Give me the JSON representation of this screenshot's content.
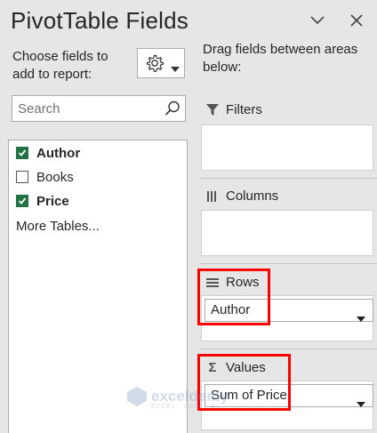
{
  "header": {
    "title": "PivotTable Fields"
  },
  "left_panel": {
    "choose_label": "Choose fields to add to report:",
    "search_placeholder": "Search",
    "fields": [
      {
        "label": "Author",
        "checked": true
      },
      {
        "label": "Books",
        "checked": false
      },
      {
        "label": "Price",
        "checked": true
      }
    ],
    "more_tables": "More Tables..."
  },
  "right_panel": {
    "drag_label": "Drag fields between areas below:",
    "areas": {
      "filters": {
        "label": "Filters"
      },
      "columns": {
        "label": "Columns"
      },
      "rows": {
        "label": "Rows",
        "item": "Author"
      },
      "values": {
        "label": "Values",
        "item": "Sum of Price"
      }
    }
  },
  "watermark": {
    "name": "exceldemy",
    "tagline": "EXCEL · DATA · BI"
  },
  "colors": {
    "accent": "#217346",
    "highlight": "#ff0000",
    "panel_bg": "#e6e6e6"
  }
}
